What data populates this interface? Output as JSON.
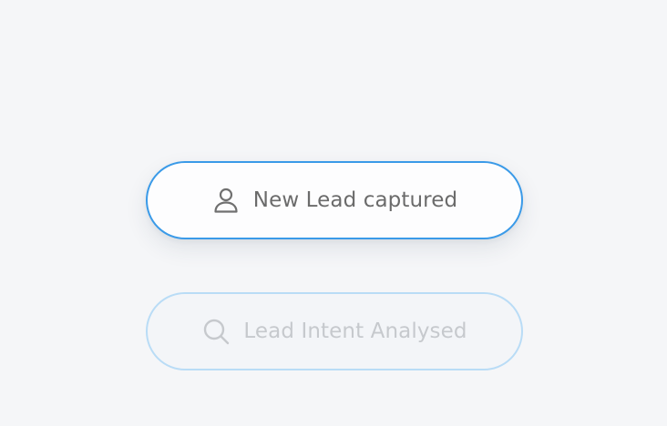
{
  "steps": [
    {
      "label": "New Lead captured",
      "icon": "user-icon",
      "state": "active",
      "accent_color": "#3a9ae8"
    },
    {
      "label": "Lead Intent Analysed",
      "icon": "search-icon",
      "state": "pending",
      "accent_color": "#b9dcf6"
    }
  ]
}
